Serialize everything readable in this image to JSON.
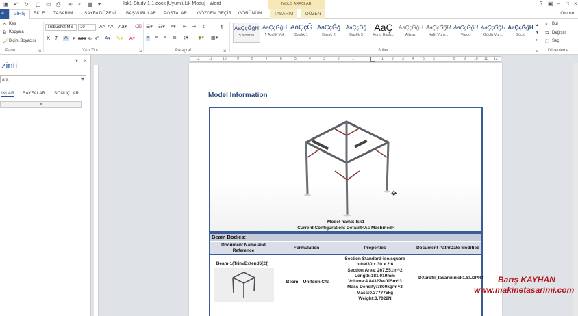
{
  "window": {
    "doc_title": "Isk1-Study 1-1.docx [Uyumluluk Modu] - Word",
    "context_header": "TABLO ARAÇLARI",
    "user": "Oturum"
  },
  "tabs": {
    "file": "A",
    "active": "GİRİŞ",
    "items": [
      "EKLE",
      "TASARIM",
      "SAYFA DÜZENİ",
      "BAŞVURULAR",
      "POSTALAR",
      "GÖZDEN GEÇİR",
      "GÖRÜNÜM"
    ],
    "context_items": [
      "TASARIM",
      "DÜZEN"
    ]
  },
  "ribbon": {
    "clipboard": {
      "cut": "Kes",
      "copy": "Kopyala",
      "format_painter": "Biçim Boyacısı",
      "label": "Pano"
    },
    "font": {
      "family": "Trebuchet MS",
      "size": "10",
      "label": "Yazı Tipi"
    },
    "paragraph": {
      "label": "Paragraf"
    },
    "styles": {
      "label": "Stiller",
      "items": [
        {
          "sample": "AaÇçĞğH",
          "name": "¶ Normal"
        },
        {
          "sample": "AaÇçĞğH",
          "name": "¶ Aralık Yok"
        },
        {
          "sample": "AaÇçĞ",
          "name": "Başlık 1"
        },
        {
          "sample": "AaÇçĞğ",
          "name": "Başlık 2"
        },
        {
          "sample": "AaÇçĞğ",
          "name": "Başlık 3"
        },
        {
          "sample": "AaÇ",
          "name": "Konu Başlı..."
        },
        {
          "sample": "AaÇçĞğH",
          "name": "Altyazı"
        },
        {
          "sample": "AaÇçĞğH",
          "name": "Hafif Vurg..."
        },
        {
          "sample": "AaÇçĞğH",
          "name": "Vurgu"
        },
        {
          "sample": "AaÇçĞğH",
          "name": "Güçlü Vur..."
        },
        {
          "sample": "AaÇçĞğH",
          "name": "Güçlü"
        }
      ]
    },
    "editing": {
      "find": "Bul",
      "replace": "Değiştir",
      "select": "Seç",
      "label": "Düzenleme"
    }
  },
  "nav": {
    "title": "zinti",
    "search_placeholder": "ara",
    "tabs": [
      "IKLAR",
      "SAYFALAR",
      "SONUÇLAR"
    ],
    "result_marker": "x"
  },
  "ruler": {
    "numbers": [
      "12",
      "11",
      "10",
      "9",
      "8",
      "7",
      "6",
      "5",
      "4",
      "3",
      "2",
      "1",
      "1",
      "2",
      "3",
      "4",
      "5",
      "6",
      "7",
      "8",
      "9",
      "10",
      "11",
      "12"
    ]
  },
  "document": {
    "heading": "Model Information",
    "model_name": "Model name: Isk1",
    "current_config": "Current Configuration: Default<As Machined>",
    "beam_title": "Beam Bodies:",
    "headers": [
      "Document Name and Reference",
      "Formulation",
      "Properties",
      "Document Path/Date Modified"
    ],
    "row": {
      "name": "Beam-1(Trim/Extend6[2])",
      "formulation": "Beam – Uniform C/S",
      "properties": [
        "Section Standard-iso/square",
        "tube/30 x 30 x 2.6",
        "Section Area: 267.551in^2",
        "Length:181.019mm",
        "Volume:4.84327e-005m^3",
        "Mass Density:7800kg/m^3",
        "Mass:0.377775kg",
        "Weight:3.7022N"
      ],
      "path": "D:\\profil_tasarımı\\Isk1.SLDPRT"
    }
  },
  "watermark": {
    "name": "Barış KAYHAN",
    "site": "www.makinetasarimi.com"
  }
}
